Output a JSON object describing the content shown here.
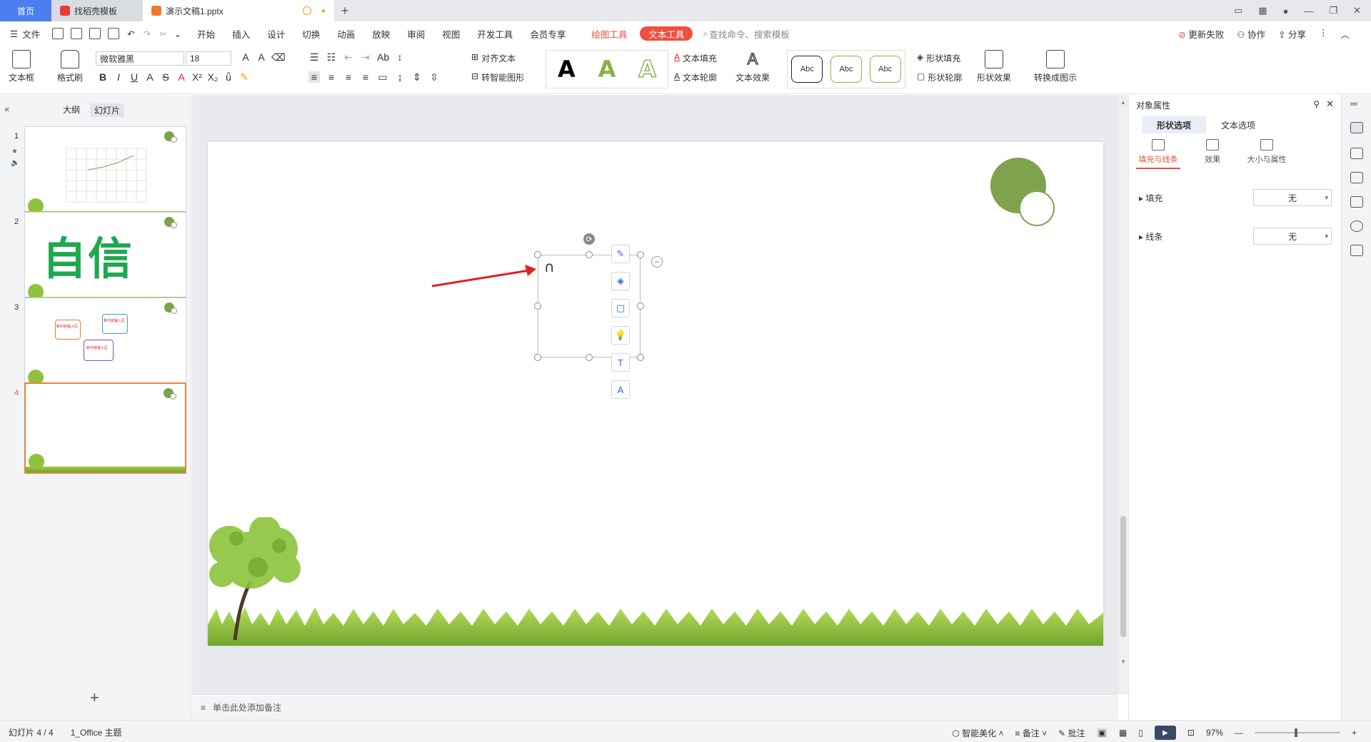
{
  "tabs": {
    "home": "首页",
    "template": "找稻壳模板",
    "doc": "演示文稿1.pptx"
  },
  "menu": {
    "file": "文件",
    "items": [
      "开始",
      "插入",
      "设计",
      "切换",
      "动画",
      "放映",
      "审阅",
      "视图",
      "开发工具",
      "会员专享"
    ],
    "drawing_tools": "绘图工具",
    "text_tools": "文本工具",
    "search_placeholder": "查找命令、搜索模板",
    "update_failed": "更新失败",
    "collaborate": "协作",
    "share": "分享"
  },
  "ribbon": {
    "textbox": "文本框",
    "format_painter": "格式刷",
    "font_name": "微软雅黑",
    "font_size": "18",
    "align_text": "对齐文本",
    "smart_shape": "转智能图形",
    "text_fill": "文本填充",
    "text_outline": "文本轮廓",
    "text_effect": "文本效果",
    "style_sample": "Abc",
    "shape_fill": "形状填充",
    "shape_outline": "形状轮廓",
    "shape_effect": "形状效果",
    "convert_diagram": "转换成图示",
    "wordart_letter": "A"
  },
  "left_pane": {
    "tab_outline": "大纲",
    "tab_slides": "幻灯片",
    "slides": [
      "1",
      "2",
      "3",
      "4"
    ],
    "slide2_text": "自信",
    "slide3_text": "新内容输入区"
  },
  "slide": {
    "textbox_char": "∩"
  },
  "notes": {
    "placeholder": "单击此处添加备注"
  },
  "right_pane": {
    "title": "对象属性",
    "tab_shape": "形状选项",
    "tab_text": "文本选项",
    "sub_fill_line": "填充与线条",
    "sub_effect": "效果",
    "sub_size": "大小与属性",
    "fill_label": "填充",
    "fill_value": "无",
    "line_label": "线条",
    "line_value": "无"
  },
  "status": {
    "slide_counter": "幻灯片 4 / 4",
    "theme": "1_Office 主题",
    "smart_beautify": "智能美化",
    "notes": "备注",
    "comments": "批注",
    "zoom": "97%"
  },
  "colors": {
    "accent": "#f04e3e",
    "home_tab": "#4d7ef0",
    "slide_circle": "#7fa24e",
    "selected_thumb": "#e8823d",
    "arrow": "#e02020"
  }
}
